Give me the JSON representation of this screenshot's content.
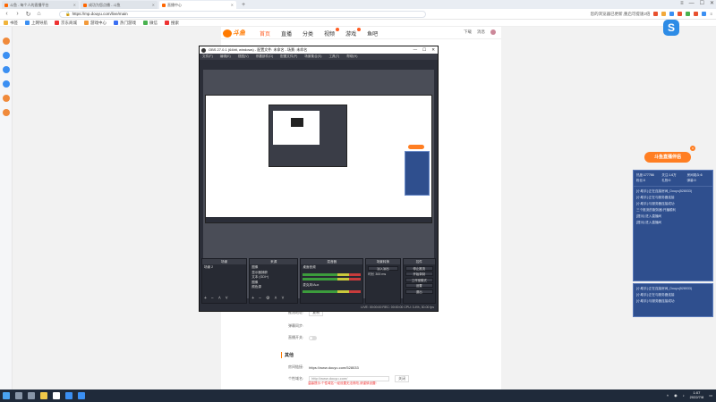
{
  "browser": {
    "tabs": [
      {
        "label": "斗鱼 - 每个人的直播平台",
        "active": false
      },
      {
        "label": "成功为您点播 - 斗鱼",
        "active": false
      },
      {
        "label": "直播中心",
        "active": true
      }
    ],
    "url": "https://mp.douyu.com/live/main",
    "address_tip": "您的浏览器已更新,重启可提速2倍",
    "bookmarks": [
      "书签",
      "上网导航",
      "京东商城",
      "游戏中心",
      "热门游戏",
      "微信",
      "搜索"
    ]
  },
  "site": {
    "logo": "斗鱼",
    "nav": [
      "首页",
      "直播",
      "分类",
      "视频",
      "游戏",
      "鱼吧"
    ],
    "active_nav": "首页",
    "nav_right": [
      "下载",
      "消息",
      "头像"
    ]
  },
  "form": {
    "toggle_label_1": "弹幕同步:",
    "toggle_label_2": "直播开关:",
    "section_title": "其他",
    "room_link_label": "房间链接:",
    "room_link_value": "https://www.douyu.com/528033",
    "custom_label": "个性域名:",
    "custom_placeholder": "http://www.douyu.com/",
    "custom_button": "关闭",
    "warning": "温馨提示:个性域名一经设置无法修改,请谨慎设置!",
    "copy_label": "复制",
    "address_label": "推流地址:"
  },
  "floating_app": "S",
  "assistant": {
    "tag": "斗鱼直播伴侣",
    "close": "x",
    "stats": [
      {
        "k": "热度:",
        "v": "177766"
      },
      {
        "k": "关注:",
        "v": "1.6万"
      },
      {
        "k": "房间观众:",
        "v": "6"
      },
      {
        "k": "粉丝:",
        "v": "0"
      },
      {
        "k": "礼物:",
        "v": "0"
      },
      {
        "k": "弹幕:",
        "v": "0"
      }
    ],
    "feed": [
      "[小助手]:正在连接房间_Douyu(528033)",
      "[小助手]:正在与服务器连接",
      "[小助手]:与服务器连接成功",
      "三个推流的服务器:开播顺利",
      "[提示]:进入直播间",
      "[提示]:进入直播间"
    ],
    "feed2": [
      "[小助手]:正在连接房间_Douyu(528033)",
      "[小助手]:正在与服务器连接",
      "[小助手]:与服务器连接成功"
    ]
  },
  "obs": {
    "title": "OBS 27.0.1 (64bit, windows) - 配置文件: 未命名 - 场景: 未命名",
    "menu": [
      "文件(F)",
      "编辑(E)",
      "视图(V)",
      "停靠部件(D)",
      "配置文件(P)",
      "场景集合(S)",
      "工具(T)",
      "帮助(H)"
    ],
    "docks": {
      "scenes": {
        "title": "场景",
        "items": [
          "场景 2"
        ]
      },
      "sources": {
        "title": "来源",
        "items": [
          "图像",
          "显示器捕获",
          "文本 (GDI+)",
          "图像",
          "颜色源"
        ]
      },
      "mixer": {
        "title": "混音器",
        "tracks": [
          "桌面音频",
          "麦克风/Aux"
        ]
      },
      "transitions": {
        "title": "场景转换",
        "type": "淡入淡出",
        "duration_label": "时长",
        "duration": "300 ms"
      },
      "controls": {
        "title": "控件",
        "buttons": [
          "停止推流",
          "开始录制",
          "工作室模式",
          "设置",
          "退出"
        ]
      }
    },
    "status": "LIVE: 00:00:00    REC: 00:00:00    CPU: 3.4%, 30.00 fps"
  },
  "taskbar": {
    "time": "1:07",
    "date": "2022/7/8"
  },
  "colors": {
    "accent": "#ff5d23",
    "douyu_orange": "#ff7a00",
    "panel_blue": "#2f4f8e",
    "obs_dark": "#2b2e38",
    "taskbar": "#1f2a3a"
  }
}
